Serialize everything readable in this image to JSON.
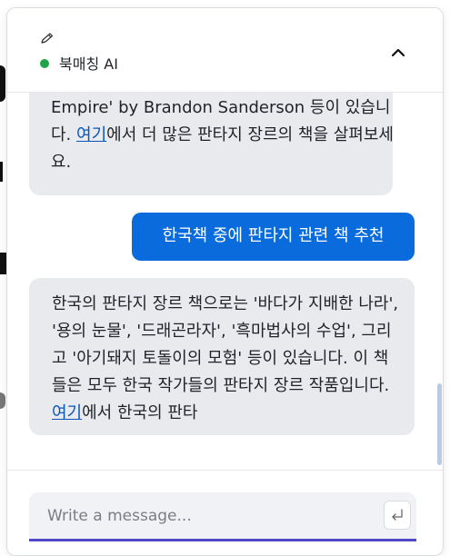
{
  "header": {
    "bot_name": "북매칭 AI",
    "status_color": "#1ea446",
    "icons": [
      "pencil-icon",
      "chevron-up-icon"
    ]
  },
  "messages": [
    {
      "role": "bot",
      "text_before_link": "Empire' by Brandon Sanderson 등이 있습니다. ",
      "link_text": "여기",
      "text_after_link": "에서 더 많은 판타지 장르의 책을 살펴보세요."
    },
    {
      "role": "user",
      "text": "한국책 중에 판타지 관련 책 추천"
    },
    {
      "role": "bot",
      "text_before_link": "한국의 판타지 장르 책으로는 '바다가 지배한 나라', '용의 눈물', '드래곤라자', '흑마법사의 수업', 그리고 '아기돼지 토돌이의 모험' 등이 있습니다. 이 책들은 모두 한국 작가들의 판타지 장르 작품입니다. ",
      "link_text": "여기",
      "text_after_link": "에서 한국의 판타"
    }
  ],
  "composer": {
    "placeholder": "Write a message...",
    "value": "",
    "send_icon": "enter-return-icon"
  },
  "colors": {
    "user_bubble": "#0a6cdc",
    "bot_bubble": "#e9eaee",
    "input_accent": "#4f49c9",
    "link": "#0a55b8"
  }
}
